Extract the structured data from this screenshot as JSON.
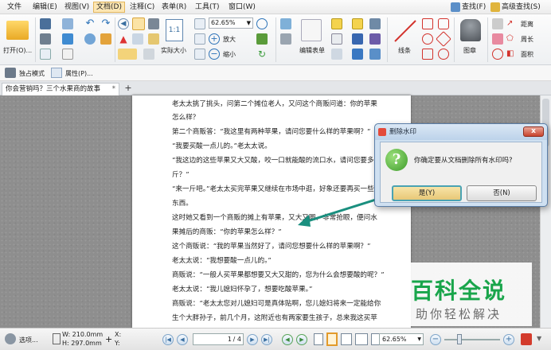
{
  "menu": {
    "items": [
      "文件",
      "编辑(E)",
      "视图(V)",
      "文档(D)",
      "注释(C)",
      "表单(R)",
      "工具(T)",
      "窗口(W)"
    ],
    "active_index": 3,
    "right": {
      "find": "查找(F)",
      "advanced_find": "高级查找(S)"
    }
  },
  "ribbon": {
    "open_label": "打开(O)...",
    "zoom_value": "62.65%",
    "zoom_in": "放大",
    "zoom_out": "缩小",
    "actual_size": "实际大小",
    "edit_form": "编辑表单",
    "lines": "线条",
    "stamp": "图章",
    "measure_distance": "距离",
    "perimeter": "周长",
    "area": "面积"
  },
  "subbar": {
    "exclusive_mode": "独占模式",
    "properties": "属性(P)..."
  },
  "tab": {
    "title": "你会营销吗？三个水果商的故事",
    "modified_mark": "*",
    "new_tab": "+"
  },
  "document": {
    "lines": [
      "老太太挑了挑头，问第二个摊位老人，又问这个商贩问道：你的苹果",
      "怎么样？",
      "第二个商贩答：“我这里有两种苹果，请问您要什么样的苹果啊？”",
      "“我要买酸一点儿的。”老太太说。",
      "“我这边的这些苹果又大又酸，咬一口就能酸的流口水，请问您要多少",
      "斤？”",
      "“来一斤吧。”老太太买完苹果又继续在市场中逛，好象还要再买一些",
      "东西。",
      "这时她又看到一个商贩的摊上有苹果，又大又圆，非常抢眼，便问水",
      "果摊后的商贩：“你的苹果怎么样？”",
      "这个商贩说：“我的苹果当然好了，请问您想要什么样的苹果啊？”",
      "老太太说：“我想要酸一点儿的。”",
      "商贩说：“一般人买苹果都想要又大又甜的，您为什么会想要酸的呢？”",
      "老太太说：“我儿媳妇怀孕了，想要吃酸苹果。”",
      "商贩说：“老太太您对儿媳妇可是真体贴啊，您儿媳妇将来一定能给你",
      "生个大胖孙子，前几个月，这附近也有两家要生孩子，总来我这买苹"
    ]
  },
  "dialog": {
    "title": "删除水印",
    "message": "你确定要从文档删除所有水印吗?",
    "yes": "是(Y)",
    "no": "否(N)",
    "icon_glyph": "?"
  },
  "status": {
    "options": "选项...",
    "width": "W: 210.0mm",
    "height": "H: 297.0mm",
    "x_label": "X:",
    "y_label": "Y:",
    "page_current": "1",
    "page_total": "/ 4",
    "zoom": "62.65%"
  },
  "watermark": {
    "brand": "百科全说",
    "slogan": "助你轻松解决"
  },
  "colors": {
    "accent": "#19a54b",
    "arrow": "#1a8f7f",
    "dialog_highlight": "#4aa3b3"
  }
}
